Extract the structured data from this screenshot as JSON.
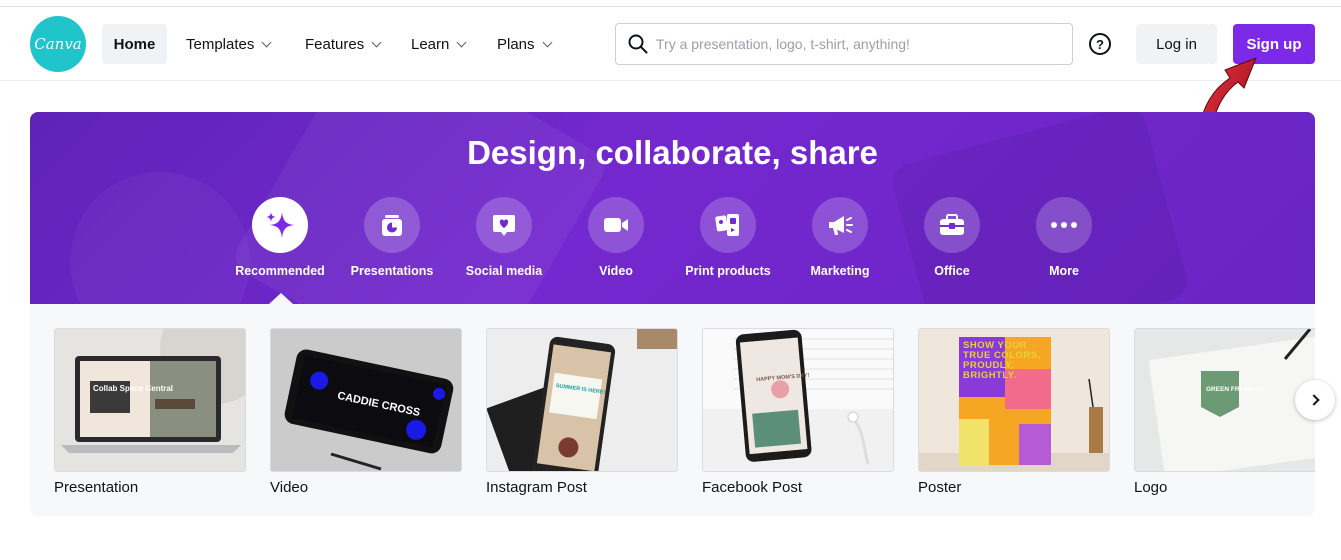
{
  "header": {
    "logo_text": "Canva",
    "nav": [
      {
        "label": "Home"
      },
      {
        "label": "Templates"
      },
      {
        "label": "Features"
      },
      {
        "label": "Learn"
      },
      {
        "label": "Plans"
      }
    ],
    "search": {
      "placeholder": "Try a presentation, logo, t-shirt, anything!",
      "value": ""
    },
    "help_icon": "question-circle-icon",
    "login_label": "Log in",
    "signup_label": "Sign up"
  },
  "hero": {
    "title": "Design, collaborate, share",
    "categories": [
      {
        "label": "Recommended",
        "icon": "sparkle-icon",
        "active": true
      },
      {
        "label": "Presentations",
        "icon": "presentation-icon"
      },
      {
        "label": "Social media",
        "icon": "heart-message-icon"
      },
      {
        "label": "Video",
        "icon": "video-camera-icon"
      },
      {
        "label": "Print products",
        "icon": "print-products-icon"
      },
      {
        "label": "Marketing",
        "icon": "megaphone-icon"
      },
      {
        "label": "Office",
        "icon": "briefcase-icon"
      },
      {
        "label": "More",
        "icon": "more-dots-icon"
      }
    ]
  },
  "templates": [
    {
      "label": "Presentation",
      "thumb_text": "Collab Space Central"
    },
    {
      "label": "Video",
      "thumb_text": "CADDIE CROSS"
    },
    {
      "label": "Instagram Post",
      "thumb_text": "SUMMER IS HERE!"
    },
    {
      "label": "Facebook Post",
      "thumb_text": "HAPPY MOM'S DAY!"
    },
    {
      "label": "Poster",
      "thumb_text": "SHOW YOUR TRUE COLORS, PROUDLY, BRIGHTLY."
    },
    {
      "label": "Logo",
      "thumb_text": "GREEN FRESH CO"
    }
  ],
  "colors": {
    "brand_purple": "#7d2ae8",
    "hero_purple": "#6a24c4",
    "logo_teal": "#20c4cb",
    "arrow_red": "#c8102e"
  }
}
